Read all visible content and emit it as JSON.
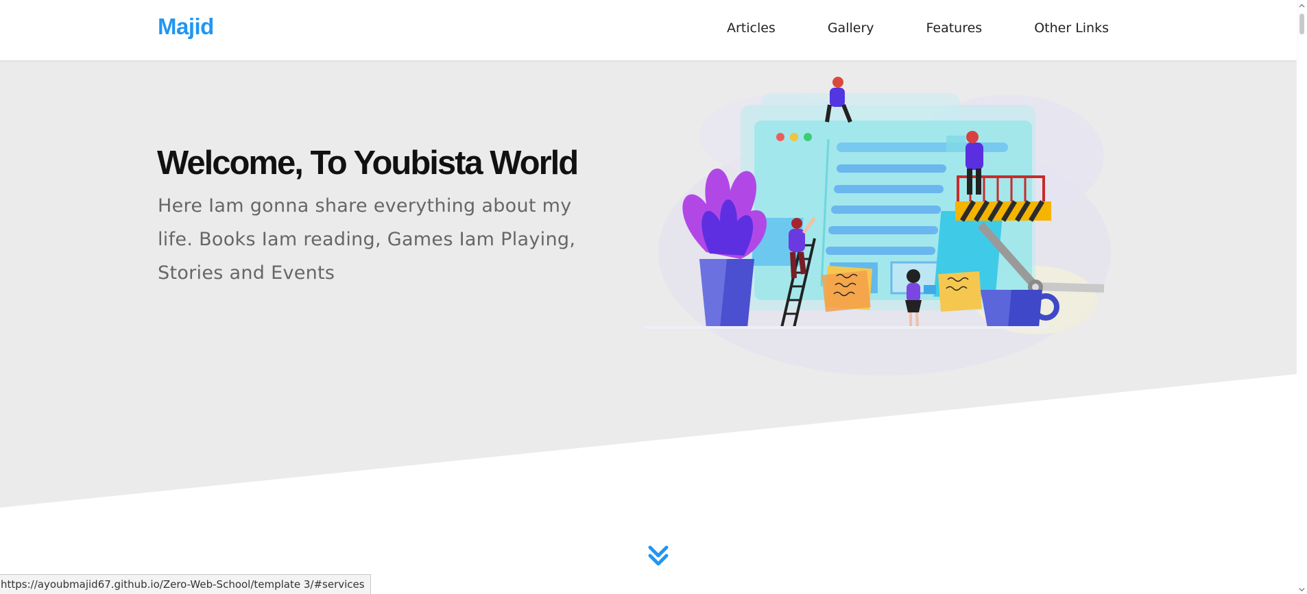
{
  "header": {
    "logo": "Majid",
    "nav": [
      "Articles",
      "Gallery",
      "Features",
      "Other Links"
    ]
  },
  "hero": {
    "title": "Welcome, To Youbista World",
    "text": "Here Iam gonna share everything about my life. Books Iam reading, Games Iam Playing, Stories and Events"
  },
  "status_bar": {
    "url": "https://ayoubmajid67.github.io/Zero-Web-School/template 3/#services"
  },
  "icons": {
    "scroll_down": "double-chevron-down-icon",
    "illustration": "website-building-illustration"
  },
  "colors": {
    "brand": "#2196f3",
    "hero_bg": "#ebebeb",
    "title": "#111111",
    "text": "#666666"
  }
}
